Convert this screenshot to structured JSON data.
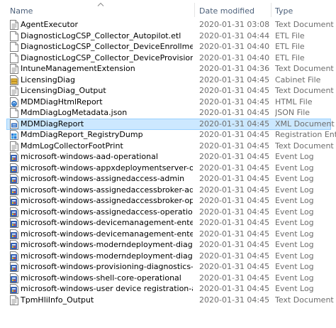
{
  "columns": {
    "name": "Name",
    "date": "Date modified",
    "type": "Type",
    "sort": "ascending"
  },
  "files": [
    {
      "name": "AgentExecutor",
      "date": "2020-01-31 03:08",
      "type": "Text Document",
      "icon": "text-document-icon"
    },
    {
      "name": "DiagnosticLogCSP_Collector_Autopilot.etl",
      "date": "2020-01-31 04:44",
      "type": "ETL File",
      "icon": "blank-file-icon"
    },
    {
      "name": "DiagnosticLogCSP_Collector_DeviceEnrollment.etl",
      "date": "2020-01-31 04:40",
      "type": "ETL File",
      "icon": "blank-file-icon"
    },
    {
      "name": "DiagnosticLogCSP_Collector_DeviceProvisioning.etl",
      "date": "2020-01-31 04:40",
      "type": "ETL File",
      "icon": "blank-file-icon"
    },
    {
      "name": "IntuneManagementExtension",
      "date": "2020-01-31 04:36",
      "type": "Text Document",
      "icon": "text-document-icon"
    },
    {
      "name": "LicensingDiag",
      "date": "2020-01-31 04:45",
      "type": "Cabinet File",
      "icon": "cabinet-file-icon"
    },
    {
      "name": "LicensingDiag_Output",
      "date": "2020-01-31 04:45",
      "type": "Text Document",
      "icon": "text-document-icon"
    },
    {
      "name": "MDMDiagHtmlReport",
      "date": "2020-01-31 04:45",
      "type": "HTML File",
      "icon": "html-file-icon"
    },
    {
      "name": "MdmDiagLogMetadata.json",
      "date": "2020-01-31 04:45",
      "type": "JSON File",
      "icon": "blank-file-icon"
    },
    {
      "name": "MDMDiagReport",
      "date": "2020-01-31 04:45",
      "type": "XML Document",
      "icon": "xml-document-icon",
      "selected": true
    },
    {
      "name": "MdmDiagReport_RegistryDump",
      "date": "2020-01-31 04:45",
      "type": "Registration Entries",
      "icon": "registry-file-icon"
    },
    {
      "name": "MdmLogCollectorFootPrint",
      "date": "2020-01-31 04:45",
      "type": "Text Document",
      "icon": "text-document-icon"
    },
    {
      "name": "microsoft-windows-aad-operational",
      "date": "2020-01-31 04:45",
      "type": "Event Log",
      "icon": "event-log-icon"
    },
    {
      "name": "microsoft-windows-appxdeploymentserver-operational",
      "date": "2020-01-31 04:45",
      "type": "Event Log",
      "icon": "event-log-icon"
    },
    {
      "name": "microsoft-windows-assignedaccess-admin",
      "date": "2020-01-31 04:45",
      "type": "Event Log",
      "icon": "event-log-icon"
    },
    {
      "name": "microsoft-windows-assignedaccessbroker-admin",
      "date": "2020-01-31 04:45",
      "type": "Event Log",
      "icon": "event-log-icon"
    },
    {
      "name": "microsoft-windows-assignedaccessbroker-operational",
      "date": "2020-01-31 04:45",
      "type": "Event Log",
      "icon": "event-log-icon"
    },
    {
      "name": "microsoft-windows-assignedaccess-operational",
      "date": "2020-01-31 04:45",
      "type": "Event Log",
      "icon": "event-log-icon"
    },
    {
      "name": "microsoft-windows-devicemanagement-enterprise-diagno...",
      "date": "2020-01-31 04:45",
      "type": "Event Log",
      "icon": "event-log-icon"
    },
    {
      "name": "microsoft-windows-devicemanagement-enterprise-diagno...",
      "date": "2020-01-31 04:45",
      "type": "Event Log",
      "icon": "event-log-icon"
    },
    {
      "name": "microsoft-windows-moderndeployment-diagnostics-provi...",
      "date": "2020-01-31 04:45",
      "type": "Event Log",
      "icon": "event-log-icon"
    },
    {
      "name": "microsoft-windows-moderndeployment-diagnostics-provi...",
      "date": "2020-01-31 04:45",
      "type": "Event Log",
      "icon": "event-log-icon"
    },
    {
      "name": "microsoft-windows-provisioning-diagnostics-provider-ad...",
      "date": "2020-01-31 04:45",
      "type": "Event Log",
      "icon": "event-log-icon"
    },
    {
      "name": "microsoft-windows-shell-core-operational",
      "date": "2020-01-31 04:45",
      "type": "Event Log",
      "icon": "event-log-icon"
    },
    {
      "name": "microsoft-windows-user device registration-admin",
      "date": "2020-01-31 04:45",
      "type": "Event Log",
      "icon": "event-log-icon"
    },
    {
      "name": "TpmHliInfo_Output",
      "date": "2020-01-31 04:45",
      "type": "Text Document",
      "icon": "text-document-icon"
    }
  ]
}
